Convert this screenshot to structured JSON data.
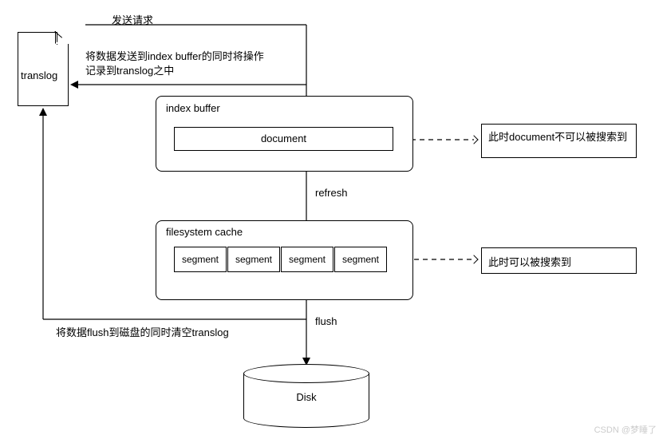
{
  "labels": {
    "send_request": "发送请求",
    "translog": "translog",
    "send_to_index_buffer": "将数据发送到index buffer的同时将操作记录到translog之中",
    "index_buffer": "index buffer",
    "document": "document",
    "refresh": "refresh",
    "filesystem_cache": "filesystem cache",
    "segment": "segment",
    "flush": "flush",
    "flush_note": "将数据flush到磁盘的同时清空translog",
    "disk": "Disk",
    "note_doc_unsearchable": "此时document不可以被搜索到",
    "note_searchable": "此时可以被搜索到",
    "watermark": "CSDN @梦睡了"
  }
}
